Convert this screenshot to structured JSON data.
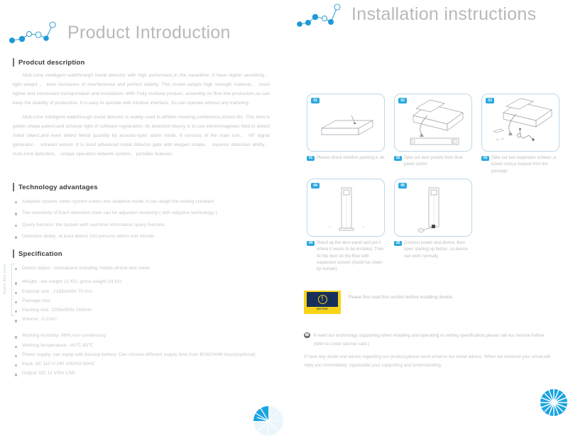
{
  "left": {
    "title": "Product Introduction",
    "sections": {
      "description": {
        "heading": "Prodcut description",
        "p1": "Muti-zone intelligent walkthrough metal detector with high performanc,in the meantime ,it have higher sensitivity、 light weight 、 best resistance of interferonnce and perfect stabilty. This model adopts high strength material、 more lighter and convenient transportation and installation. With Fully modular product, assembly on flow line production,so can keep the stability of production. It is easy to operate with intuitive interface. So can operate without any trainning.",
        "p2": "Muti-zone intelligent walkthrough metal detector is widely used in athletic meeting,conference,school etc. This item is gotten shape patent,and achieve right of software registration. Its detection theory is to use electromagnetic field to detect metal object,and even detect Metal quantity by acousto-optic alarm mode. It consists of the main unit、 HF signal generator、 infrared sensor. It is most advanced metal detector gate with elegant shape、 superior detection ability、 muti-zone detection、 unique operation network system、 portable features."
      },
      "advantages": {
        "heading": "Technology advantages",
        "items": [
          "Adaptive system: when system enters into adaptive mode, it can adapt the testing standard",
          "The sensitivity of Each detection zone can be adjusted randomly ( with adaptive technology )",
          "Query function: the system with real-time information query function.",
          "Detection ability: at least detect 100 persons within one minute."
        ]
      },
      "specification": {
        "heading": "Specification",
        "side_label": "double door panel",
        "items": [
          "Detect object : contraband including mobile phone and metal",
          "Weight : net weight 21 KG, gross weight 24 KG;",
          "External size : 2185x430x 70 mm",
          "Passage size:",
          "Packing size: 2258x583x 163mm",
          "Volume : 0.21m³",
          "Working humidity: 99%,non-condensing",
          "Working temperature: -40℃-85℃",
          "Power supply: can equip with backup battery. Can choose different supply time from 8/16/24/48 hours(optional)",
          "Input: AC 110 V-240 V/50HZ-60HZ",
          "Output: DC 12 V/5A  12W"
        ]
      }
    }
  },
  "right": {
    "title": "Installation instructions",
    "steps": [
      {
        "num": "01",
        "caption": "Please check whether packing is ok",
        "icon": "flat-carton-icon"
      },
      {
        "num": "02",
        "caption": "Take out door panels from door panel carton",
        "icon": "open-carton-panel-icon"
      },
      {
        "num": "03",
        "caption": "Take out two expansion schews ,a power cord,a manual from the package",
        "icon": "carton-accessories-icon"
      },
      {
        "num": "04",
        "caption": "Stand up the door panel and put it where it needs to be installed, Then fix the door on the floor with expansion screws (Avoid run down by human)",
        "icon": "standing-panel-icon"
      },
      {
        "num": "05",
        "caption": "Connect power and device, then open starting up button, so device can work normally",
        "icon": "panel-power-cord-icon"
      }
    ],
    "notice": {
      "word": "NOTICE",
      "symbol": "!",
      "text": "Please first read this section before installing device."
    },
    "contact": {
      "line1": "If need our technology supporting when installing and operating or setting specification,please call our service hotline. (refer to cover service card )",
      "line2": "If have any doubt and advice regarding our product,please send email to our email adress. When we received your email,will reply you immediately. Appreciate your supporting and understanding."
    }
  },
  "colors": {
    "accent": "#29a8e0",
    "logo_blue": "#1c9ad6",
    "box_border": "#bcd8ea",
    "notice_yellow": "#f7d417",
    "notice_navy": "#16305b",
    "heading": "#3a3a3a",
    "body_text": "#c3c3c3"
  }
}
